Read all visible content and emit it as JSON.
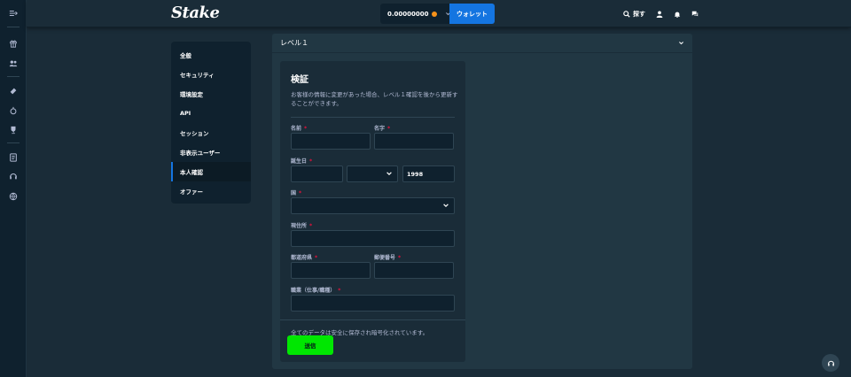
{
  "header": {
    "logo": "Stake",
    "balance": "0.00000000",
    "wallet_label": "ウォレット",
    "search_label": "探す"
  },
  "settings_menu": {
    "items": [
      {
        "label": "全般",
        "active": false
      },
      {
        "label": "セキュリティ",
        "active": false
      },
      {
        "label": "環境設定",
        "active": false
      },
      {
        "label": "API",
        "active": false
      },
      {
        "label": "セッション",
        "active": false
      },
      {
        "label": "非表示ユーザー",
        "active": false
      },
      {
        "label": "本人確認",
        "active": true
      },
      {
        "label": "オファー",
        "active": false
      }
    ]
  },
  "level_panel": {
    "title": "レベル１"
  },
  "verification": {
    "title": "検証",
    "description": "お客様の情報に変更があった場合、レベル１確認を後から更新することができます。",
    "fields": {
      "first_name": {
        "label": "名前",
        "value": ""
      },
      "last_name": {
        "label": "名字",
        "value": ""
      },
      "birthdate": {
        "label": "誕生日",
        "day": "",
        "month": "",
        "year": "1998"
      },
      "country": {
        "label": "国",
        "value": ""
      },
      "address": {
        "label": "現住所",
        "value": ""
      },
      "prefecture": {
        "label": "都道府県",
        "value": ""
      },
      "postal_code": {
        "label": "郵便番号",
        "value": ""
      },
      "occupation": {
        "label": "職業（仕事/職種）",
        "value": ""
      }
    },
    "required_marker": "*",
    "footer_note": "全てのデータは安全に保存され暗号化されています。",
    "submit_label": "送信"
  },
  "colors": {
    "background": "#1a2c38",
    "rail": "#0f212e",
    "panel": "#213743",
    "accent_blue": "#1475e1",
    "submit_green": "#00e701",
    "required_red": "#e9113c",
    "bitcoin_orange": "#f7931a"
  }
}
